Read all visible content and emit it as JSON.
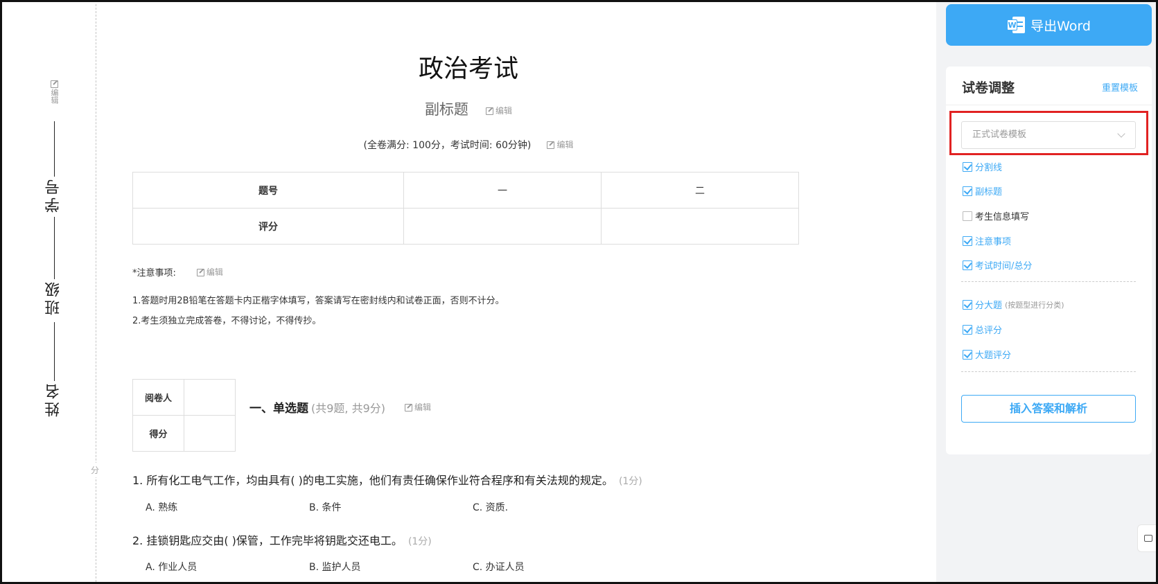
{
  "paper": {
    "title": "政治考试",
    "subtitle": "副标题",
    "info": "(全卷满分: 100分，考试时间: 60分钟)",
    "edit_label": "编辑",
    "seal_mark": "分",
    "student_fields": [
      {
        "label": "学号"
      },
      {
        "label": "班级"
      },
      {
        "label": "姓名"
      }
    ],
    "score_table": {
      "row_headers": [
        "题号",
        "评分"
      ],
      "columns": [
        "一",
        "二"
      ]
    },
    "notice": {
      "head": "*注意事项:",
      "lines": [
        "1.答题时用2B铅笔在答题卡内正楷字体填写，答案请写在密封线内和试卷正面，否则不计分。",
        "2.考生须独立完成答卷，不得讨论，不得传抄。"
      ]
    },
    "grader": {
      "reviewer": "阅卷人",
      "score": "得分"
    },
    "section": {
      "title": "一、单选题",
      "count": "(共9题, 共9分)"
    },
    "questions": [
      {
        "text": "1. 所有化工电气工作，均由具有(  )的电工实施，他们有责任确保作业符合程序和有关法规的规定。",
        "points": "(1分)",
        "options": [
          "A. 熟练",
          "B. 条件",
          "C. 资质."
        ]
      },
      {
        "text": "2. 挂锁钥匙应交由(  )保管，工作完毕将钥匙交还电工。",
        "points": "(1分)",
        "options": [
          "A. 作业人员",
          "B. 监护人员",
          "C. 办证人员"
        ]
      }
    ]
  },
  "sidebar": {
    "export_label": "导出Word",
    "export_icon": "word-icon",
    "panel_title": "试卷调整",
    "reset_label": "重置模板",
    "template_select": "正式试卷模板",
    "options_group1": [
      {
        "label": "分割线",
        "checked": true
      },
      {
        "label": "副标题",
        "checked": true
      },
      {
        "label": "考生信息填写",
        "checked": false
      },
      {
        "label": "注意事项",
        "checked": true
      },
      {
        "label": "考试时间/总分",
        "checked": true
      }
    ],
    "options_group2": [
      {
        "label": "分大题",
        "checked": true,
        "note": "(按题型进行分类)"
      },
      {
        "label": "总评分",
        "checked": true
      },
      {
        "label": "大题评分",
        "checked": true
      }
    ],
    "insert_label": "插入答案和解析",
    "accent_color": "#3da9f5",
    "highlight_color": "#e12222"
  }
}
